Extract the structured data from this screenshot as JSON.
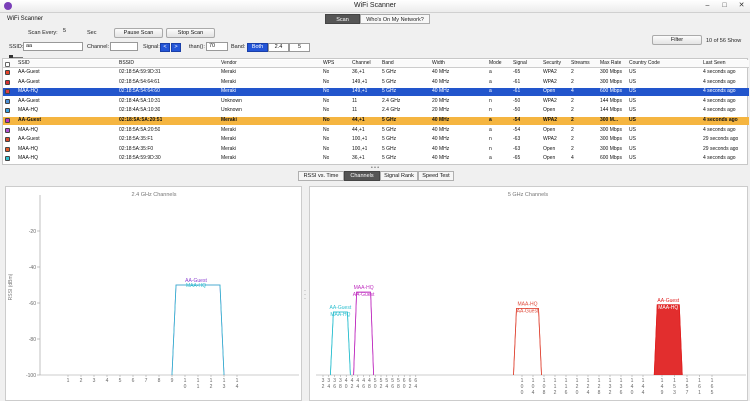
{
  "window": {
    "title": "WiFi Scanner"
  },
  "menubar": {
    "label": "WiFi Scanner",
    "tabs": [
      "Scan",
      "Who's On My Network?"
    ]
  },
  "toolbar": {
    "scan_every_label": "Scan Every:",
    "scan_every_value": "5",
    "sec_label": "Sec",
    "pause_label": "Pause Scan",
    "stop_label": "Stop Scan",
    "ssid_label": "SSID:",
    "ssid_value": "aa",
    "channel_label": "Channel:",
    "channel_value": "",
    "signal_label": "Signal:",
    "signal_lt": "<",
    "signal_gt": ">",
    "than_label": "than():",
    "than_value": "70",
    "band_label": "Band:",
    "band_options": [
      "Both",
      "2.4",
      "5"
    ],
    "band_selected": "Both",
    "filter_label": "Filter",
    "count_text": "10 of 56 Show"
  },
  "table": {
    "columns": [
      "SSID",
      "BSSID",
      "Vendor",
      "WPS",
      "Channel",
      "Band",
      "Width",
      "Mode",
      "Signal",
      "Security",
      "Streams",
      "Max Rate",
      "Country Code",
      "Last Seen"
    ],
    "rows": [
      {
        "ssid": "AA-Guest",
        "bssid": "02:18:5A:59:9D:31",
        "vendor": "Meraki",
        "wps": "No",
        "channel": "36,+1",
        "band": "5 GHz",
        "width": "40 MHz",
        "mode": "a",
        "signal": "-65",
        "security": "WPA2",
        "streams": "2",
        "max_rate": "300 Mbps",
        "country": "US",
        "last_seen": "4 seconds ago",
        "color": "#e8432a",
        "style": "normal"
      },
      {
        "ssid": "AA-Guest",
        "bssid": "02:18:5A:54:64:61",
        "vendor": "Meraki",
        "wps": "No",
        "channel": "149,+1",
        "band": "5 GHz",
        "width": "40 MHz",
        "mode": "a",
        "signal": "-61",
        "security": "WPA2",
        "streams": "2",
        "max_rate": "300 Mbps",
        "country": "US",
        "last_seen": "4 seconds ago",
        "color": "#d63030",
        "style": "normal"
      },
      {
        "ssid": "MAA-HQ",
        "bssid": "02:18:5A:54:64:60",
        "vendor": "Meraki",
        "wps": "No",
        "channel": "149,+1",
        "band": "5 GHz",
        "width": "40 MHz",
        "mode": "a",
        "signal": "-61",
        "security": "Open",
        "streams": "4",
        "max_rate": "600 Mbps",
        "country": "US",
        "last_seen": "4 seconds ago",
        "color": "#e04040",
        "style": "selected"
      },
      {
        "ssid": "AA-Guest",
        "bssid": "02:18:4A:5A:10:31",
        "vendor": "Unknown",
        "wps": "No",
        "channel": "11",
        "band": "2.4 GHz",
        "width": "20 MHz",
        "mode": "n",
        "signal": "-50",
        "security": "WPA2",
        "streams": "2",
        "max_rate": "144 Mbps",
        "country": "US",
        "last_seen": "4 seconds ago",
        "color": "#4a8fd8",
        "style": "normal"
      },
      {
        "ssid": "MAA-HQ",
        "bssid": "02:18:4A:5A:10:30",
        "vendor": "Unknown",
        "wps": "No",
        "channel": "11",
        "band": "2.4 GHz",
        "width": "20 MHz",
        "mode": "n",
        "signal": "-50",
        "security": "Open",
        "streams": "2",
        "max_rate": "144 Mbps",
        "country": "US",
        "last_seen": "4 seconds ago",
        "color": "#3aa0e0",
        "style": "normal"
      },
      {
        "ssid": "AA-Guest",
        "bssid": "02:18:5A:5A:20:51",
        "vendor": "Meraki",
        "wps": "No",
        "channel": "44,+1",
        "band": "5 GHz",
        "width": "40 MHz",
        "mode": "a",
        "signal": "-54",
        "security": "WPA2",
        "streams": "2",
        "max_rate": "300 M...",
        "country": "US",
        "last_seen": "4 seconds ago",
        "color": "#c030c0",
        "style": "highlight"
      },
      {
        "ssid": "MAA-HQ",
        "bssid": "02:18:5A:5A:20:50",
        "vendor": "Meraki",
        "wps": "No",
        "channel": "44,+1",
        "band": "5 GHz",
        "width": "40 MHz",
        "mode": "a",
        "signal": "-54",
        "security": "Open",
        "streams": "2",
        "max_rate": "300 Mbps",
        "country": "US",
        "last_seen": "4 seconds ago",
        "color": "#b050d0",
        "style": "normal"
      },
      {
        "ssid": "AA-Guest",
        "bssid": "02:18:5A:35:F1",
        "vendor": "Meraki",
        "wps": "No",
        "channel": "100,+1",
        "band": "5 GHz",
        "width": "40 MHz",
        "mode": "n",
        "signal": "-63",
        "security": "WPA2",
        "streams": "2",
        "max_rate": "300 Mbps",
        "country": "US",
        "last_seen": "29 seconds ago",
        "color": "#d84a2a",
        "style": "normal"
      },
      {
        "ssid": "MAA-HQ",
        "bssid": "02:18:5A:35:F0",
        "vendor": "Meraki",
        "wps": "No",
        "channel": "100,+1",
        "band": "5 GHz",
        "width": "40 MHz",
        "mode": "n",
        "signal": "-63",
        "security": "Open",
        "streams": "2",
        "max_rate": "300 Mbps",
        "country": "US",
        "last_seen": "29 seconds ago",
        "color": "#e05a2a",
        "style": "normal"
      },
      {
        "ssid": "MAA-HQ",
        "bssid": "02:18:5A:59:9D:30",
        "vendor": "Meraki",
        "wps": "No",
        "channel": "36,+1",
        "band": "5 GHz",
        "width": "40 MHz",
        "mode": "a",
        "signal": "-65",
        "security": "Open",
        "streams": "4",
        "max_rate": "600 Mbps",
        "country": "US",
        "last_seen": "4 seconds ago",
        "color": "#30c0d0",
        "style": "normal"
      }
    ]
  },
  "view_tabs": [
    "RSSI vs. Time",
    "Channels",
    "Signal Rank",
    "Speed Test"
  ],
  "view_tabs_selected": "Channels",
  "colors": {
    "selected_row": "#2255cc",
    "highlight_row": "#f5b540",
    "accent": "#2355d8"
  },
  "chart_data": [
    {
      "type": "area",
      "title": "2.4 GHz Channels",
      "ylabel": "RSSI (dBm)",
      "ylim": [
        -100,
        0
      ],
      "yticks": [
        -20,
        -40,
        -60,
        -80,
        -100
      ],
      "x_tick_labels": [
        "1",
        "2",
        "3",
        "4",
        "5",
        "6",
        "7",
        "8",
        "9",
        "10",
        "11",
        "12",
        "13",
        "14"
      ],
      "series": [
        {
          "name": "AA-Guest",
          "channel": 11,
          "signal": -50,
          "color": "#8a3fd0"
        },
        {
          "name": "MAA-HQ",
          "channel": 11,
          "signal": -50,
          "color": "#30c0d0"
        }
      ]
    },
    {
      "type": "area",
      "title": "5 GHz Channels",
      "ylim": [
        -100,
        0
      ],
      "x_tick_labels": [
        "32",
        "34",
        "36",
        "38",
        "40",
        "42",
        "44",
        "46",
        "48",
        "50",
        "52",
        "54",
        "56",
        "58",
        "60",
        "62",
        "64",
        "100",
        "104",
        "108",
        "112",
        "116",
        "120",
        "124",
        "128",
        "132",
        "136",
        "140",
        "144",
        "149",
        "153",
        "157",
        "161",
        "165"
      ],
      "series": [
        {
          "name": "AA-Guest",
          "channel": 38,
          "signal": -65,
          "color": "#30c0d0"
        },
        {
          "name": "MAA-HQ",
          "channel": 38,
          "signal": -65,
          "color": "#30c0d0"
        },
        {
          "name": "MAA-HQ",
          "channel": 46,
          "signal": -54,
          "color": "#c030c0"
        },
        {
          "name": "AA-Guest",
          "channel": 46,
          "signal": -54,
          "color": "#c030c0"
        },
        {
          "name": "MAA-HQ",
          "channel": 102,
          "signal": -63,
          "color": "#e04a3a"
        },
        {
          "name": "AA-Guest",
          "channel": 102,
          "signal": -63,
          "color": "#e04a3a"
        },
        {
          "name": "AA-Guest",
          "channel": 151,
          "signal": -61,
          "color": "#e02020"
        },
        {
          "name": "MAA-HQ",
          "channel": 151,
          "signal": -61,
          "color": "#e02020"
        }
      ]
    }
  ]
}
